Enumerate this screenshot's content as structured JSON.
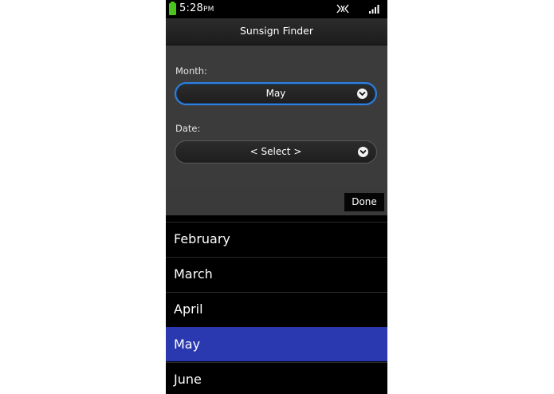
{
  "status_bar": {
    "time": "5:28",
    "ampm": "PM",
    "battery_color": "#4bc51c",
    "icons": [
      "battery-icon",
      "network-icon",
      "signal-icon"
    ]
  },
  "title_bar": {
    "title": "Sunsign Finder"
  },
  "form": {
    "month": {
      "label": "Month:",
      "value": "May"
    },
    "date": {
      "label": "Date:",
      "value": "< Select >"
    }
  },
  "picker": {
    "done_label": "Done",
    "items": [
      "February",
      "March",
      "April",
      "May",
      "June"
    ],
    "selected": "May",
    "selected_color": "#2b39b0"
  }
}
